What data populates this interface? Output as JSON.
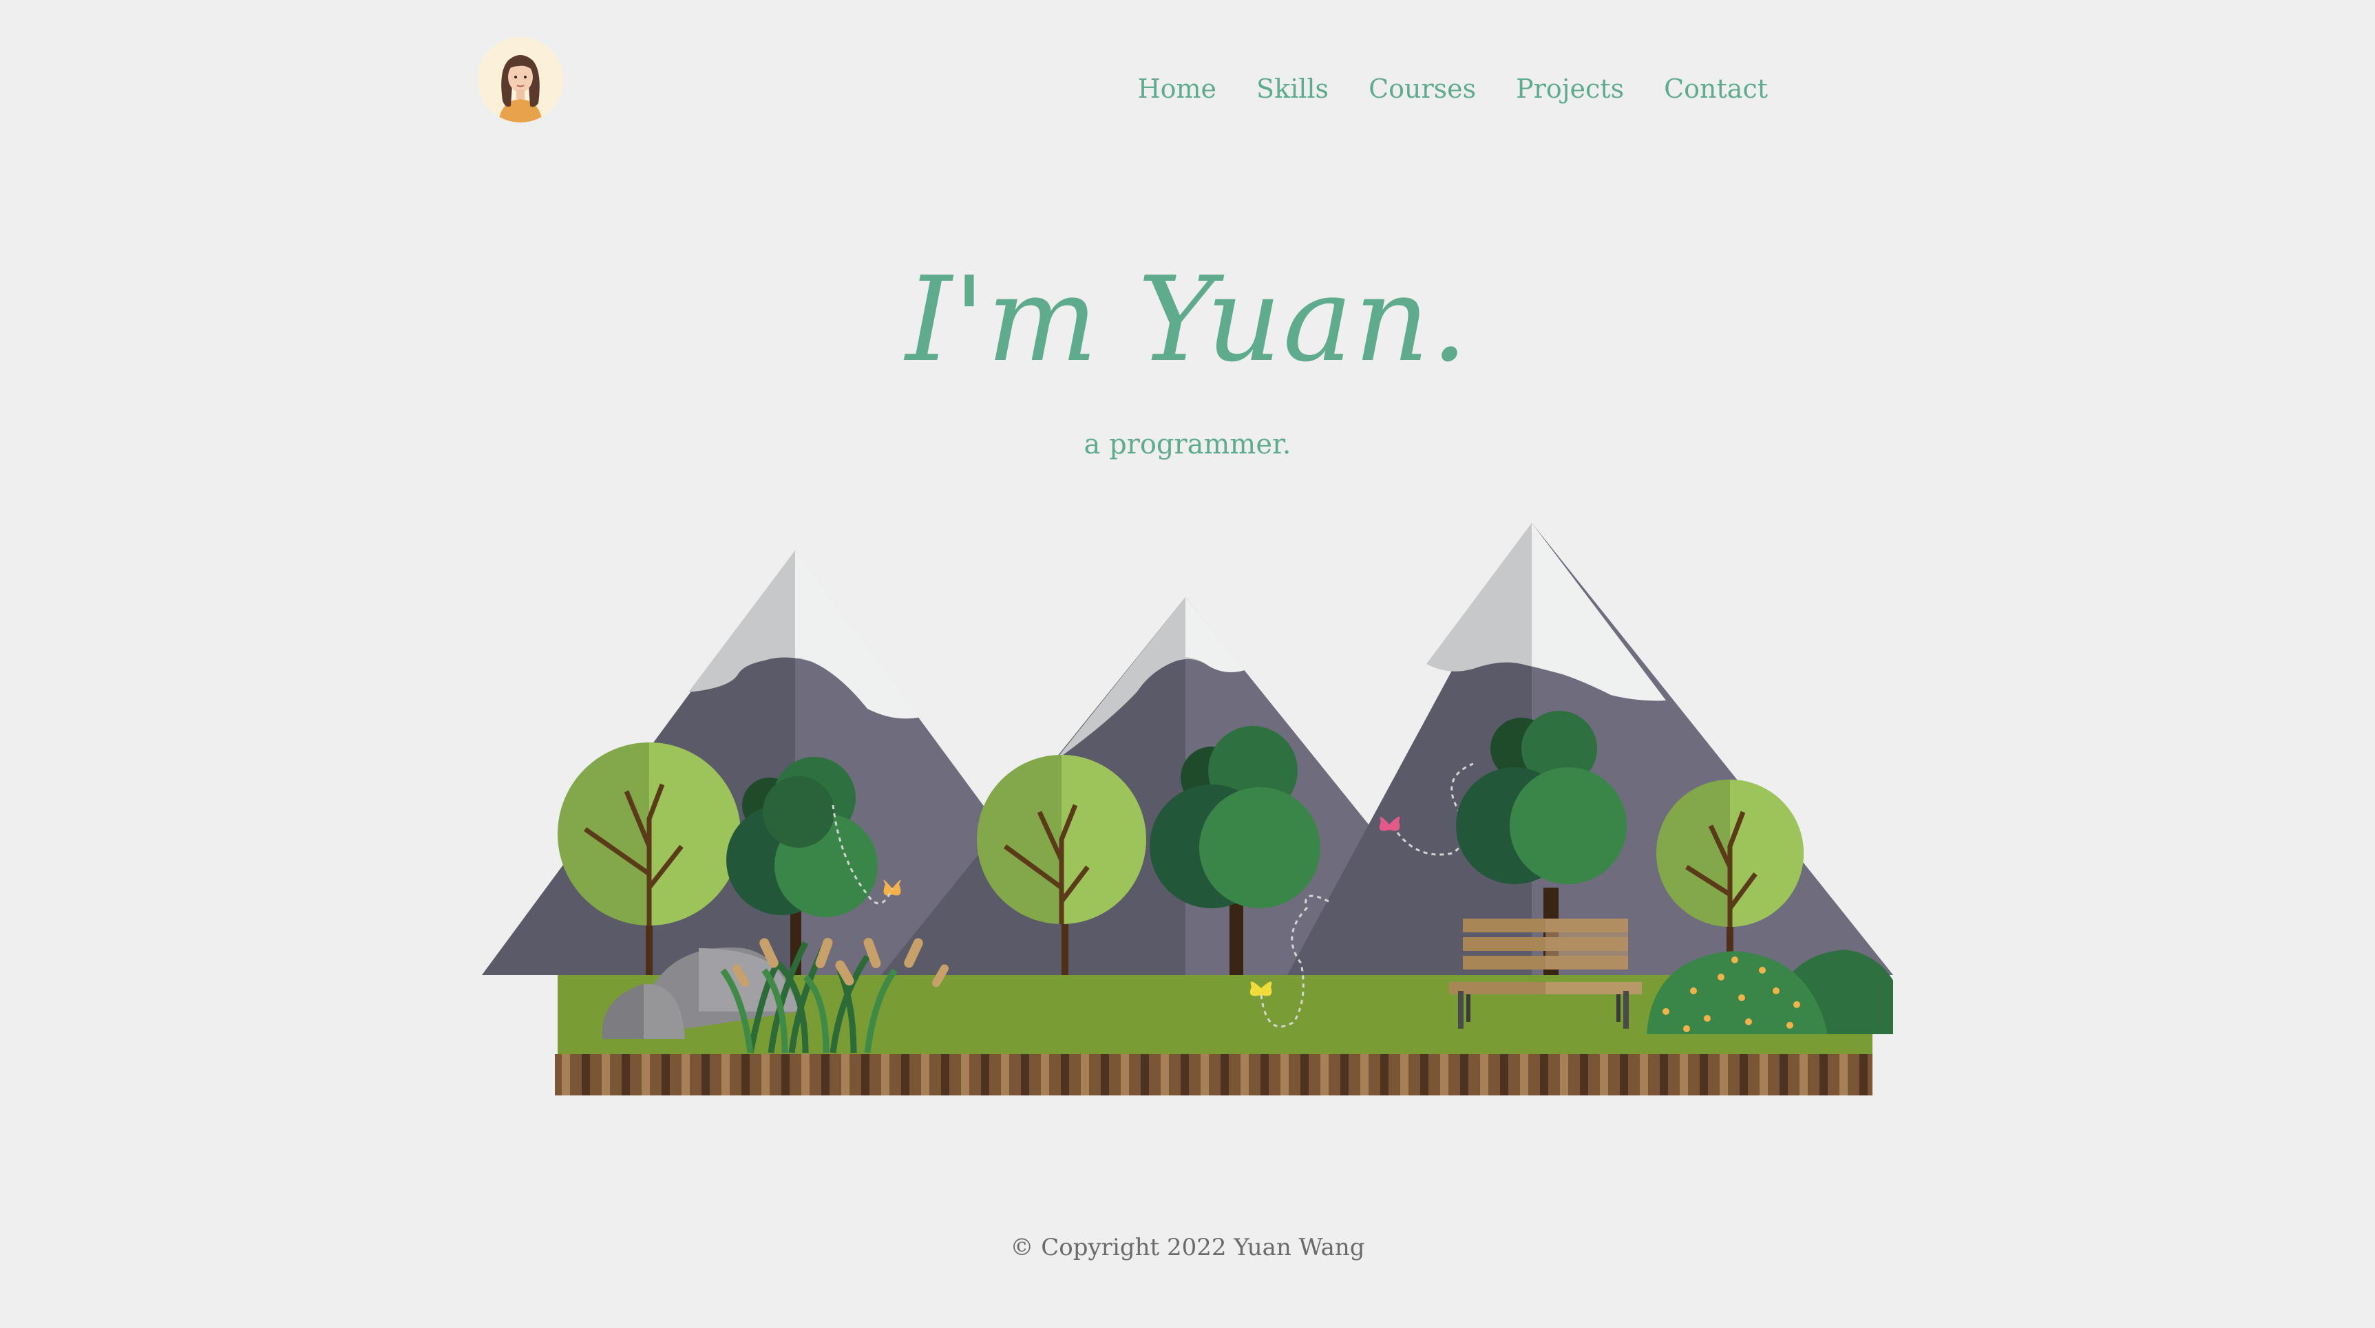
{
  "header": {
    "avatar_icon": "portrait-avatar-icon",
    "nav": [
      {
        "label": "Home"
      },
      {
        "label": "Skills"
      },
      {
        "label": "Courses"
      },
      {
        "label": "Projects"
      },
      {
        "label": "Contact"
      }
    ]
  },
  "hero": {
    "title": "I'm Yuan.",
    "subtitle": "a programmer."
  },
  "illustration": {
    "icon": "mountain-park-landscape-illustration",
    "elements": [
      "mountains",
      "trees",
      "rock",
      "cattails",
      "butterflies",
      "bench",
      "bush"
    ]
  },
  "footer": {
    "copyright": "© Copyright 2022 Yuan Wang"
  },
  "colors": {
    "accent": "#5fab8e",
    "background": "#efefef",
    "footer_text": "#6a6a6a"
  }
}
